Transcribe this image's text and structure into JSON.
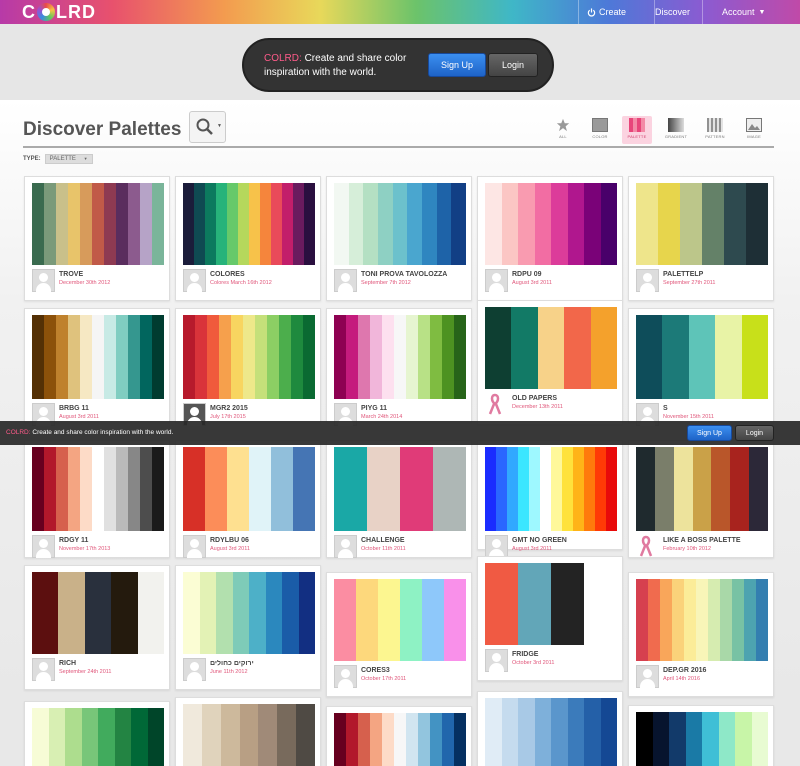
{
  "header": {
    "logo_text": "C  LRD",
    "nav": [
      {
        "label": "Create",
        "icon": "power-icon"
      },
      {
        "label": "Discover"
      },
      {
        "label": "Account",
        "icon": "dropdown-arrow-icon"
      }
    ]
  },
  "promo": {
    "brand": "COLRD:",
    "text": "Create and share color inspiration with the world.",
    "signup": "Sign Up",
    "login": "Login"
  },
  "page": {
    "title": "Discover Palettes",
    "type_label": "TYPE:",
    "type_value": "PALETTE",
    "filters": [
      {
        "label": "ALL",
        "icon": "star-icon"
      },
      {
        "label": "COLOR",
        "icon": "color-icon"
      },
      {
        "label": "PALETTE",
        "icon": "palette-icon",
        "active": true
      },
      {
        "label": "GRADIENT",
        "icon": "gradient-icon"
      },
      {
        "label": "PATTERN",
        "icon": "pattern-icon"
      },
      {
        "label": "IMAGE",
        "icon": "image-icon"
      }
    ]
  },
  "cards": [
    {
      "name": "TROVE",
      "date": "December 30th 2012",
      "colors": [
        "#3a6b4f",
        "#7a9a7a",
        "#c9c08a",
        "#e8c46a",
        "#d79b5b",
        "#c15a48",
        "#8e3a52",
        "#5a2d5e",
        "#8c5b8e",
        "#b6a3c7",
        "#7ab59a"
      ]
    },
    {
      "name": "COLORES",
      "date": "Colores March 16th 2012",
      "colors": [
        "#1b1c3a",
        "#0f4a52",
        "#0c7a5e",
        "#27b37a",
        "#66c96a",
        "#b5d85c",
        "#f7c24a",
        "#f5853c",
        "#e94a5a",
        "#c21e6a",
        "#6a1b5e",
        "#2a0f3f"
      ]
    },
    {
      "name": "TONI PROVA TAVOLOZZA",
      "date": "September 7th 2012",
      "colors": [
        "#f2f8f2",
        "#d6eed9",
        "#b4e0c3",
        "#8ed0c3",
        "#6cc1cc",
        "#4aa6cf",
        "#2f86c0",
        "#1e63a8",
        "#123f85"
      ]
    },
    {
      "name": "RDPU 09",
      "date": "August 3rd 2011",
      "colors": [
        "#fde6e4",
        "#fbc6c4",
        "#f99bb0",
        "#f26da3",
        "#dc3c9a",
        "#b0178e",
        "#7a0278",
        "#49006a"
      ]
    },
    {
      "name": "PALETTELP",
      "date": "September 27th 2011",
      "colors": [
        "#eee58b",
        "#e7d54c",
        "#bcc68a",
        "#648168",
        "#2e4a4f",
        "#1e2f36"
      ]
    },
    {
      "name": "BRBG 11",
      "date": "August 3rd 2011",
      "colors": [
        "#543005",
        "#8c510a",
        "#bf812d",
        "#dfc27d",
        "#f6e8c3",
        "#f5f5f5",
        "#c7eae5",
        "#80cdc1",
        "#35978f",
        "#01665e",
        "#003c30"
      ]
    },
    {
      "name": "MGR2 2015",
      "date": "July 17th 2015",
      "colors": [
        "#b71a2c",
        "#d9333a",
        "#f05a3c",
        "#f6a04c",
        "#f8d560",
        "#eee88a",
        "#c5e07a",
        "#8ccf64",
        "#4cae4c",
        "#1e8a3e",
        "#0a6a32"
      ]
    },
    {
      "name": "PIYG 11",
      "date": "March 24th 2014",
      "colors": [
        "#8e0152",
        "#c51b7d",
        "#de77ae",
        "#f1b6da",
        "#fde0ef",
        "#f7f7f7",
        "#e6f5d0",
        "#b8e186",
        "#7fbc41",
        "#4d9221",
        "#276419"
      ]
    },
    {
      "name": "OLD PAPERS",
      "date": "December 13th 2011",
      "colors": [
        "#0e3f32",
        "#127a66",
        "#f7d289",
        "#f2674a",
        "#f4a12c"
      ]
    },
    {
      "name": "S",
      "date": "November 15th 2011",
      "colors": [
        "#0e4d5a",
        "#1c7a78",
        "#5ec4b8",
        "#e8f3a6",
        "#c8e01a"
      ]
    },
    {
      "name": "RDGY 11",
      "date": "November 17th 2013",
      "colors": [
        "#67001f",
        "#b2182b",
        "#d6604d",
        "#f4a582",
        "#fddbc7",
        "#ffffff",
        "#e0e0e0",
        "#bababa",
        "#878787",
        "#4d4d4d",
        "#1a1a1a"
      ]
    },
    {
      "name": "RDYLBU 06",
      "date": "August 3rd 2011",
      "colors": [
        "#d73027",
        "#fc8d59",
        "#fee090",
        "#e0f3f8",
        "#91bfdb",
        "#4575b4"
      ]
    },
    {
      "name": "CHALLENGE",
      "date": "October 11th 2011",
      "colors": [
        "#1aa8a6",
        "#e8d2c6",
        "#e03b78",
        "#aeb7b5"
      ]
    },
    {
      "name": "GMT NO GREEN",
      "date": "August 3rd 2011",
      "colors": [
        "#1a2cff",
        "#2a66ff",
        "#31a8ff",
        "#3be6ff",
        "#9ef8ff",
        "#ffffff",
        "#fff89a",
        "#ffe23c",
        "#ffb418",
        "#ff7a0c",
        "#ff3a06",
        "#e80a0a"
      ]
    },
    {
      "name": "LIKE A BOSS PALETTE",
      "date": "February 10th 2012",
      "colors": [
        "#1f2a2e",
        "#7a7e6a",
        "#ede39c",
        "#caa148",
        "#b9562a",
        "#a8231e",
        "#2c2838"
      ]
    },
    {
      "name": "RICH",
      "date": "September 24th 2011",
      "colors": [
        "#5c0f0f",
        "#c9b189",
        "#29303d",
        "#241a0d",
        "#f2f2ee"
      ]
    },
    {
      "name": "ירוקים כחולים",
      "date": "June 11th 2012",
      "colors": [
        "#fbfdd4",
        "#e3f2b5",
        "#b2e0ae",
        "#7ecbb8",
        "#4db0c8",
        "#2b88be",
        "#1a5ca8",
        "#122f82"
      ]
    },
    {
      "name": "CORES3",
      "date": "October 17th 2011",
      "colors": [
        "#fb8da2",
        "#fdd87c",
        "#fcf690",
        "#8ef2c4",
        "#8ec8fa",
        "#f990ea"
      ]
    },
    {
      "name": "FRIDGE",
      "date": "October 3rd 2011",
      "colors": [
        "#f05a43",
        "#62a6b8",
        "#232323",
        "#ffffff"
      ]
    },
    {
      "name": "DEP.GR 2016",
      "date": "April 14th 2016",
      "colors": [
        "#d6404f",
        "#f06b4e",
        "#f9a65a",
        "#fad27a",
        "#fbec98",
        "#f8f5b8",
        "#d6ecb0",
        "#a9d8a8",
        "#78c2a4",
        "#4da3b0",
        "#337eb0"
      ]
    },
    {
      "name": "",
      "date": "",
      "colors": [
        "#f7fcd6",
        "#d8efb3",
        "#addd8e",
        "#78c679",
        "#41ab5d",
        "#238443",
        "#006837",
        "#004529"
      ]
    },
    {
      "name": "",
      "date": "",
      "colors": [
        "#f0e9dc",
        "#e0d3bc",
        "#cdb99c",
        "#b89f84",
        "#a08a78",
        "#786a5c",
        "#4f4a44"
      ]
    },
    {
      "name": "",
      "date": "",
      "colors": [
        "#67001f",
        "#b2182b",
        "#d6604d",
        "#f4a582",
        "#fddbc7",
        "#f7f7f7",
        "#d1e5f0",
        "#92c5de",
        "#4393c3",
        "#2166ac",
        "#053061"
      ]
    },
    {
      "name": "",
      "date": "",
      "colors": [
        "#e0ecf6",
        "#c5dbee",
        "#a8c9e6",
        "#7eb0da",
        "#5a96cc",
        "#3b7bbb",
        "#2460a8",
        "#144894"
      ]
    },
    {
      "name": "",
      "date": "",
      "colors": [
        "#000000",
        "#07142e",
        "#123a6a",
        "#1a7aa6",
        "#3fbfd6",
        "#8ee8c8",
        "#c8f5a8",
        "#e8fbd2"
      ]
    }
  ],
  "overlay": {
    "brand": "COLRD:",
    "text": "Create and share color inspiration with the world.",
    "signup": "Sign Up",
    "login": "Login"
  }
}
